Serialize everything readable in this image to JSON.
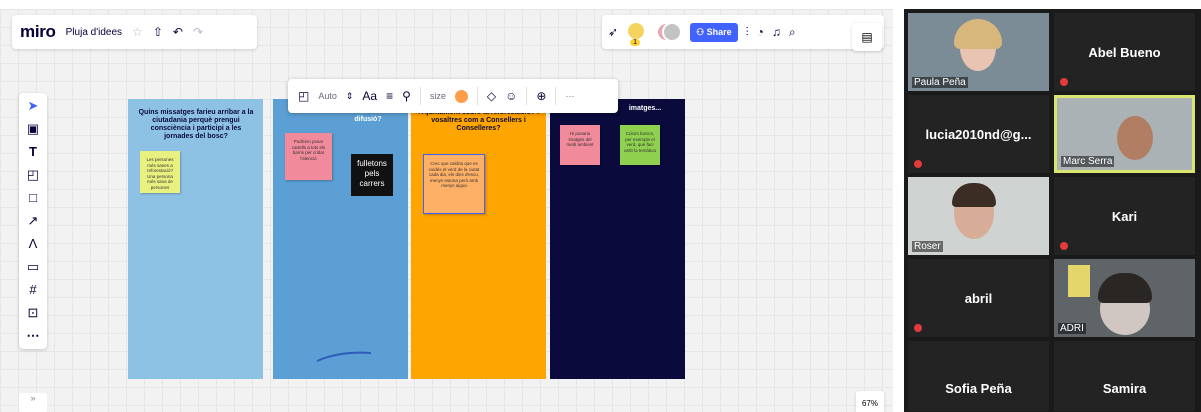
{
  "miro": {
    "logo": "miro",
    "board_name": "Pluja d'idees",
    "share_label": "Share",
    "avatar_count": "1",
    "zoom_level": "67%",
    "expand_label": "»"
  },
  "context_toolbar": {
    "font_mode": "Auto",
    "font_label": "Aa",
    "size_label": "size",
    "more_label": "···"
  },
  "columns": [
    {
      "title": "Quins missatges farieu arribar a la ciutadania perquè prengui consciència i participi a les jornades del bosc?"
    },
    {
      "title": "difusió?"
    },
    {
      "title": "l'Ajuntament sobre la reforestació? i vosaltres com a Consellers i Conselleres?"
    },
    {
      "title": "imatges..."
    }
  ],
  "stickies": {
    "green1": "Les persones més sanes a reforestació? Una persona més sana de persones",
    "pink1": "Podríem posar cartells a tots els barris per cridar l'atenció",
    "dark1": "fulletons pels carrers",
    "orange1": "Crec que caldria que es cuidés el verd de la ciutat cada dia, els dies d'escu, menys estona però amb menys aigua",
    "pink2": "Hi posaria imatges del medi ambient",
    "green2": "Colors bonics, per exemple el verd, que faci amb la temàtica"
  },
  "participants": [
    {
      "name": "Paula Peña"
    },
    {
      "name": "Abel Bueno"
    },
    {
      "name": "lucia2010nd@g..."
    },
    {
      "name": "Marc Serra"
    },
    {
      "name": "Roser"
    },
    {
      "name": "Kari"
    },
    {
      "name": "abril"
    },
    {
      "name": "ADRI"
    },
    {
      "name": "Sofia Peña"
    },
    {
      "name": "Samira"
    }
  ],
  "colors": {
    "col1": "#8ec2e4",
    "col2": "#5b9fd4",
    "col3": "#ffa500",
    "col4": "#0a0a3c",
    "active_speaker": "#d9e56e"
  }
}
